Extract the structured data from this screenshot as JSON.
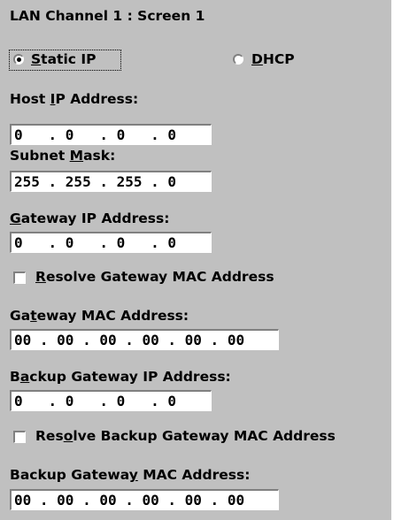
{
  "title": "LAN Channel 1 : Screen 1",
  "mode": {
    "static_label": "Static IP",
    "static_selected": true,
    "dhcp_label": "DHCP",
    "dhcp_selected": false
  },
  "host_ip": {
    "label": "Host IP Address:",
    "value": "0   . 0   . 0   . 0"
  },
  "subnet_mask": {
    "label": "Subnet Mask:",
    "value": "255 . 255 . 255 . 0"
  },
  "gateway_ip": {
    "label": "Gateway IP Address:",
    "value": "0   . 0   . 0   . 0"
  },
  "resolve_gateway_mac": {
    "label": "Resolve Gateway MAC Address",
    "checked": false
  },
  "gateway_mac": {
    "label": "Gateway MAC Address:",
    "value": "00 . 00 . 00 . 00 . 00 . 00"
  },
  "backup_gateway_ip": {
    "label": "Backup Gateway IP Address:",
    "value": "0   . 0   . 0   . 0"
  },
  "resolve_backup_gateway_mac": {
    "label": "Resolve Backup Gateway MAC Address",
    "checked": false
  },
  "backup_gateway_mac": {
    "label": "Backup Gateway MAC Address:",
    "value": "00 . 00 . 00 . 00 . 00 . 00"
  },
  "colors": {
    "panel_bg": "#c0c0c0",
    "field_bg": "#ffffff",
    "text": "#000000"
  }
}
